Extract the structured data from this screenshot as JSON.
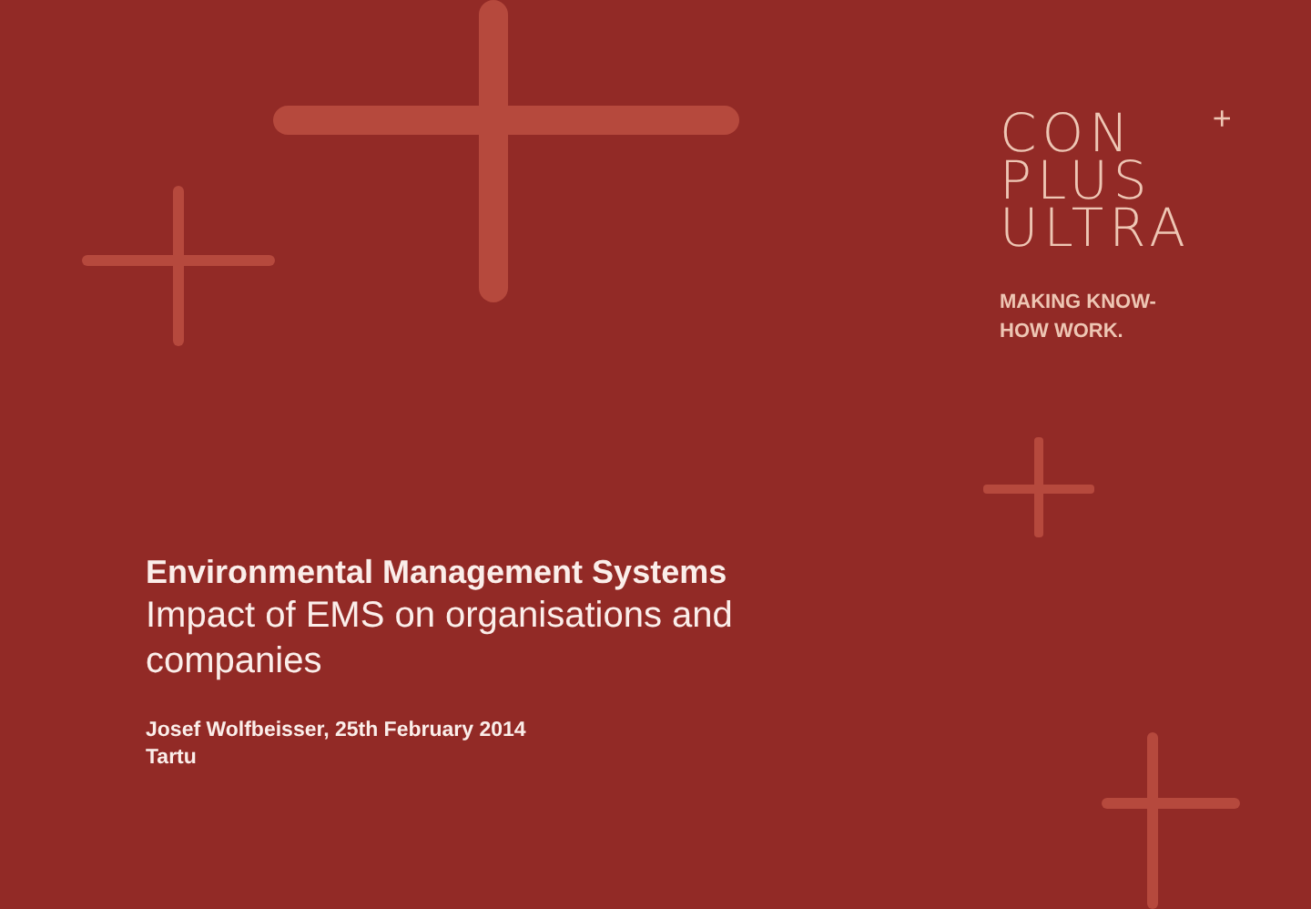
{
  "logo": {
    "lines": [
      "CON",
      "PLUS",
      "ULTRA"
    ],
    "plus": "+",
    "tagline": "MAKING KNOW-\nHOW WORK."
  },
  "title": "Environmental Management Systems",
  "subtitle": "Impact of EMS on organisations and companies",
  "author_line": "Josef Wolfbeisser, 25th February 2014",
  "location": "Tartu"
}
